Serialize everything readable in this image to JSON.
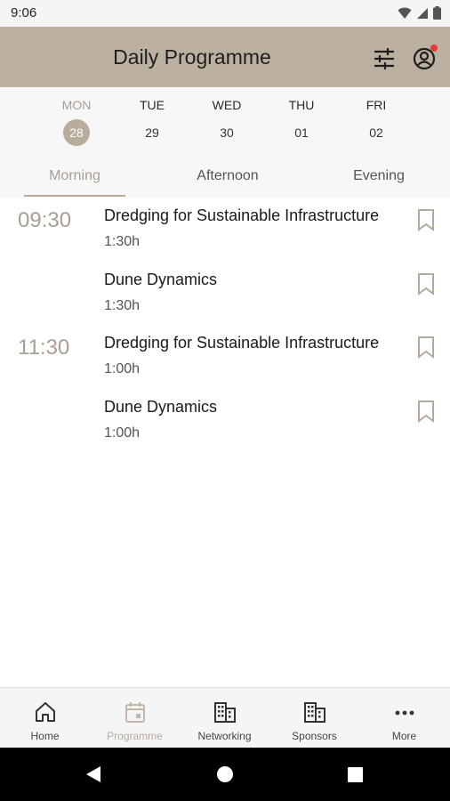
{
  "status_bar": {
    "time": "9:06",
    "icons": [
      "wifi-icon",
      "signal-icon",
      "battery-icon"
    ]
  },
  "header": {
    "title": "Daily Programme",
    "icons": [
      "filter-icon",
      "profile-icon"
    ],
    "notification_dot": true
  },
  "days": [
    {
      "name": "MON",
      "date": "28",
      "selected": true
    },
    {
      "name": "TUE",
      "date": "29",
      "selected": false
    },
    {
      "name": "WED",
      "date": "30",
      "selected": false
    },
    {
      "name": "THU",
      "date": "01",
      "selected": false
    },
    {
      "name": "FRI",
      "date": "02",
      "selected": false
    }
  ],
  "tabs": [
    {
      "label": "Morning",
      "selected": true
    },
    {
      "label": "Afternoon",
      "selected": false
    },
    {
      "label": "Evening",
      "selected": false
    }
  ],
  "sessions": [
    {
      "time": "09:30",
      "title": "Dredging for Sustainable Infrastructure",
      "duration": "1:30h",
      "bookmark_icon": "bookmark-outline-icon"
    },
    {
      "time": "",
      "title": "Dune Dynamics",
      "duration": "1:30h",
      "bookmark_icon": "bookmark-outline-icon"
    },
    {
      "time": "11:30",
      "title": "Dredging for Sustainable Infrastructure",
      "duration": "1:00h",
      "bookmark_icon": "bookmark-outline-icon"
    },
    {
      "time": "",
      "title": "Dune Dynamics",
      "duration": "1:00h",
      "bookmark_icon": "bookmark-outline-icon"
    }
  ],
  "bottom_nav": [
    {
      "label": "Home",
      "icon": "home-icon",
      "active": false
    },
    {
      "label": "Programme",
      "icon": "calendar-icon",
      "active": true
    },
    {
      "label": "Networking",
      "icon": "building-icon",
      "active": false
    },
    {
      "label": "Sponsors",
      "icon": "building-icon",
      "active": false
    },
    {
      "label": "More",
      "icon": "more-dots-icon",
      "active": false
    }
  ],
  "colors": {
    "header_bg": "#bcb1a1",
    "accent": "#b8ad9d",
    "accent_text": "#a89f92",
    "notification": "#e53935"
  }
}
